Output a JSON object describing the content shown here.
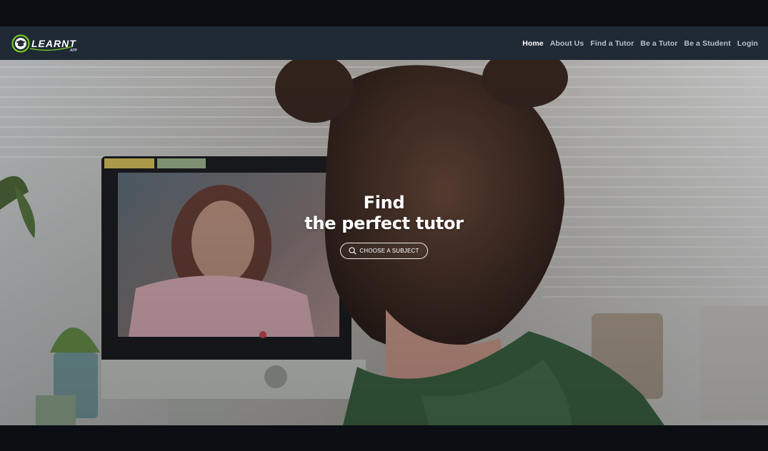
{
  "brand": {
    "logo_text": "LEARNT",
    "logo_subtext": "APP",
    "accent": "#7ed321"
  },
  "nav": {
    "items": [
      {
        "label": "Home",
        "active": true
      },
      {
        "label": "About Us",
        "active": false
      },
      {
        "label": "Find a Tutor",
        "active": false
      },
      {
        "label": "Be a Tutor",
        "active": false
      },
      {
        "label": "Be a Student",
        "active": false
      },
      {
        "label": "Login",
        "active": false
      }
    ]
  },
  "hero": {
    "title_line1": "Find",
    "title_line2": "the perfect tutor",
    "button_label": "CHOOSE A SUBJECT",
    "button_icon": "search-icon"
  },
  "colors": {
    "navbar": "#1f2a35",
    "page_bands": "#0b0f14",
    "nav_text": "#b9c0c7",
    "nav_active": "#ffffff"
  }
}
